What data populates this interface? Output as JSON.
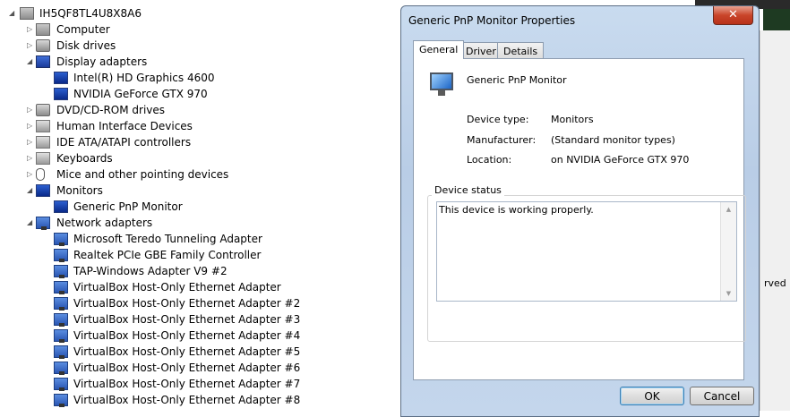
{
  "tree": {
    "root": "IH5QF8TL4U8X8A6",
    "categories": [
      {
        "label": "Computer",
        "icon": "computer-icon",
        "expanded": false
      },
      {
        "label": "Disk drives",
        "icon": "disk-drive-icon",
        "expanded": false
      },
      {
        "label": "Display adapters",
        "icon": "display-adapter-icon",
        "expanded": true,
        "children": [
          "Intel(R) HD Graphics 4600",
          "NVIDIA GeForce GTX 970"
        ]
      },
      {
        "label": "DVD/CD-ROM drives",
        "icon": "dvd-drive-icon",
        "expanded": false
      },
      {
        "label": "Human Interface Devices",
        "icon": "hid-icon",
        "expanded": false
      },
      {
        "label": "IDE ATA/ATAPI controllers",
        "icon": "ide-controller-icon",
        "expanded": false
      },
      {
        "label": "Keyboards",
        "icon": "keyboard-icon",
        "expanded": false
      },
      {
        "label": "Mice and other pointing devices",
        "icon": "mouse-icon",
        "expanded": false
      },
      {
        "label": "Monitors",
        "icon": "monitor-icon",
        "expanded": true,
        "children": [
          "Generic PnP Monitor"
        ]
      },
      {
        "label": "Network adapters",
        "icon": "network-adapter-icon",
        "expanded": true,
        "children": [
          "Microsoft Teredo Tunneling Adapter",
          "Realtek PCIe GBE Family Controller",
          "TAP-Windows Adapter V9 #2",
          "VirtualBox Host-Only Ethernet Adapter",
          "VirtualBox Host-Only Ethernet Adapter #2",
          "VirtualBox Host-Only Ethernet Adapter #3",
          "VirtualBox Host-Only Ethernet Adapter #4",
          "VirtualBox Host-Only Ethernet Adapter #5",
          "VirtualBox Host-Only Ethernet Adapter #6",
          "VirtualBox Host-Only Ethernet Adapter #7",
          "VirtualBox Host-Only Ethernet Adapter #8"
        ]
      }
    ]
  },
  "background": {
    "partial_text": "rved"
  },
  "dialog": {
    "title": "Generic PnP Monitor Properties",
    "close_glyph": "✕",
    "tabs": [
      "General",
      "Driver",
      "Details"
    ],
    "active_tab": "General",
    "device_name": "Generic PnP Monitor",
    "fields": [
      {
        "label": "Device type:",
        "value": "Monitors"
      },
      {
        "label": "Manufacturer:",
        "value": "(Standard monitor types)"
      },
      {
        "label": "Location:",
        "value": "on NVIDIA GeForce GTX 970"
      }
    ],
    "status_group_label": "Device status",
    "status_text": "This device is working properly.",
    "ok_label": "OK",
    "cancel_label": "Cancel"
  },
  "colors": {
    "dialog_frame": "#c4d6ec",
    "close_button": "#c9452a",
    "accent": "#3c7fb1"
  }
}
